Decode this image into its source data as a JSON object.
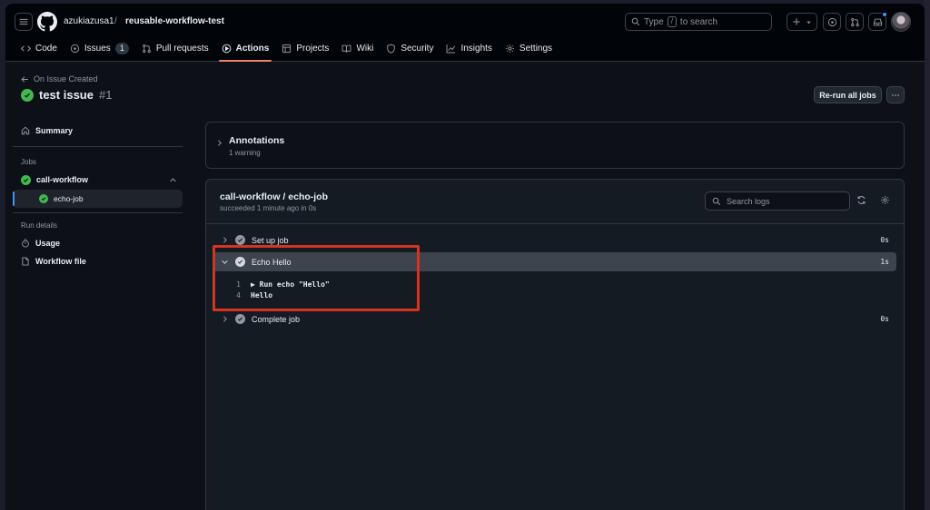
{
  "header": {
    "owner": "azukiazusa1",
    "separator": "/",
    "repo": "reusable-workflow-test",
    "search_placeholder_prefix": "Type",
    "search_key": "/",
    "search_placeholder_suffix": "to search",
    "notification_color": "#4493f8"
  },
  "tabs": [
    {
      "label": "Code",
      "icon": "code-icon"
    },
    {
      "label": "Issues",
      "icon": "issue-opened-icon",
      "count": "1"
    },
    {
      "label": "Pull requests",
      "icon": "git-pull-request-icon"
    },
    {
      "label": "Actions",
      "icon": "play-icon",
      "active": true
    },
    {
      "label": "Projects",
      "icon": "table-icon"
    },
    {
      "label": "Wiki",
      "icon": "book-icon"
    },
    {
      "label": "Security",
      "icon": "shield-icon"
    },
    {
      "label": "Insights",
      "icon": "graph-icon"
    },
    {
      "label": "Settings",
      "icon": "gear-icon"
    }
  ],
  "run": {
    "back_label": "On Issue Created",
    "title": "test issue",
    "number": "#1",
    "rerun_label": "Re-run all jobs",
    "status_color": "#3fb950"
  },
  "sidebar": {
    "summary": "Summary",
    "jobs_heading": "Jobs",
    "workflow": "call-workflow",
    "job": "echo-job",
    "run_details_heading": "Run details",
    "usage": "Usage",
    "workflow_file": "Workflow file"
  },
  "annotations": {
    "title": "Annotations",
    "subtitle": "1 warning"
  },
  "job": {
    "title": "call-workflow / echo-job",
    "subtitle": "succeeded 1 minute ago in 0s",
    "search_placeholder": "Search logs",
    "steps": [
      {
        "name": "Set up job",
        "duration": "0s"
      },
      {
        "name": "Echo Hello",
        "duration": "1s",
        "expanded": true
      },
      {
        "name": "Complete job",
        "duration": "0s"
      }
    ],
    "log_lines": [
      {
        "number": "1",
        "text": "▶ Run echo \"Hello\""
      },
      {
        "number": "4",
        "text": "Hello"
      }
    ]
  },
  "highlight_color": "#d6341f"
}
